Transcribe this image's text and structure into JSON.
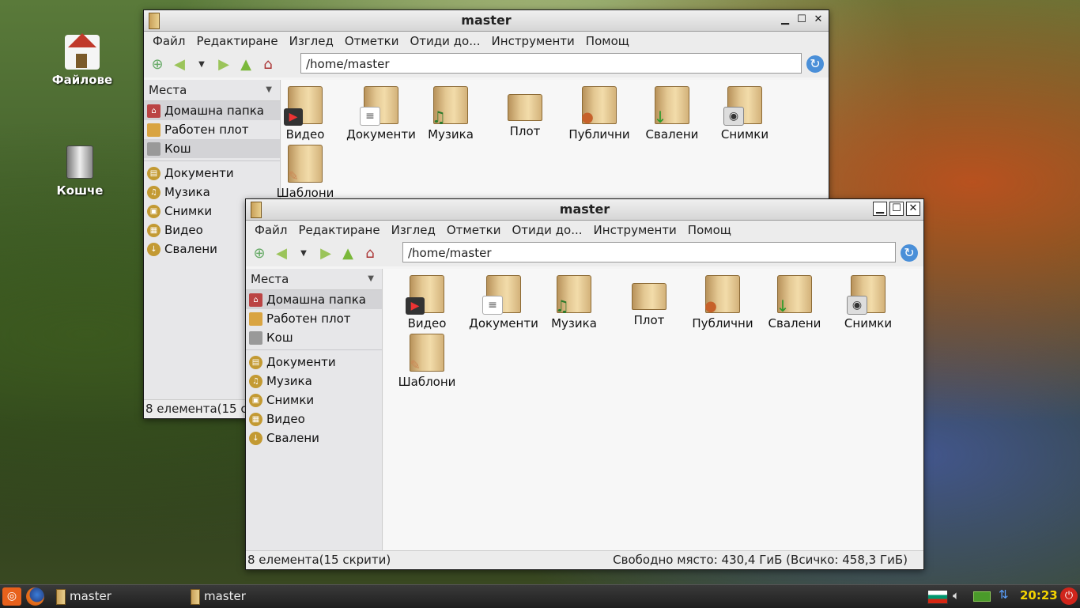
{
  "desktop": {
    "icons": [
      {
        "label": "Файлове",
        "icon": "home-icon"
      },
      {
        "label": "Кошче",
        "icon": "trash-icon"
      }
    ]
  },
  "window": {
    "title": "master",
    "menu": [
      "Файл",
      "Редактиране",
      "Изглед",
      "Отметки",
      "Отиди до...",
      "Инструменти",
      "Помощ"
    ],
    "path": "/home/master",
    "places_header": "Места",
    "places": [
      "Домашна папка",
      "Работен плот",
      "Кош"
    ],
    "bookmarks": [
      "Документи",
      "Музика",
      "Снимки",
      "Видео",
      "Свалени"
    ],
    "files": [
      "Видео",
      "Документи",
      "Музика",
      "Плот",
      "Публични",
      "Свалени",
      "Снимки",
      "Шаблони"
    ],
    "status_left": "8 елемента(15 скрити)",
    "status_left_partial": "8 елемента(15 ск",
    "status_right": "Свободно място: 430,4 ГиБ (Всичко: 458,3 ГиБ)"
  },
  "taskbar": {
    "tasks": [
      "master",
      "master"
    ],
    "clock": "20:23"
  },
  "colors": {
    "accent": "#4a8fd8",
    "folder": "#e4c893",
    "clock": "#f5d400"
  }
}
